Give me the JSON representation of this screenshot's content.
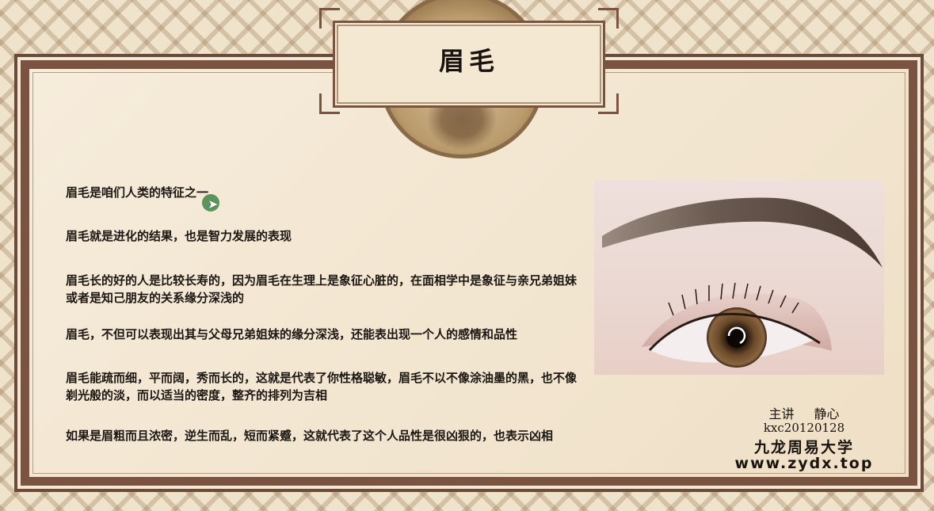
{
  "slide": {
    "title": "眉毛",
    "paragraphs": [
      "眉毛是咱们人类的特征之一",
      "眉毛就是进化的结果，也是智力发展的表现",
      "眉毛长的好的人是比较长寿的，因为眉毛在生理上是象征心脏的，在面相学中是象征与亲兄弟姐妹或者是知己朋友的关系缘分深浅的",
      "眉毛，不但可以表现出其与父母兄弟姐妹的缘分深浅，还能表出现一个人的感情和品性",
      "眉毛能疏而细，平而阔，秀而长的，这就是代表了你性格聪敏，眉毛不以不像涂油墨的黑，也不像剃光般的淡，而以适当的密度，整齐的排列为吉相",
      "如果是眉粗而且浓密，逆生而乱，短而紧蹙，这就代表了这个人品性是很凶狠的，也表示凶相"
    ],
    "credits": {
      "speaker": "主讲 静心",
      "id": "kxc20120128",
      "university": "九龙周易大学",
      "website": "www.zydx.top"
    },
    "photo_subject": "eyebrow-and-eye-photo",
    "colors": {
      "frame": "#7a5441",
      "background": "#efe3cc",
      "text": "#1c1712"
    }
  }
}
